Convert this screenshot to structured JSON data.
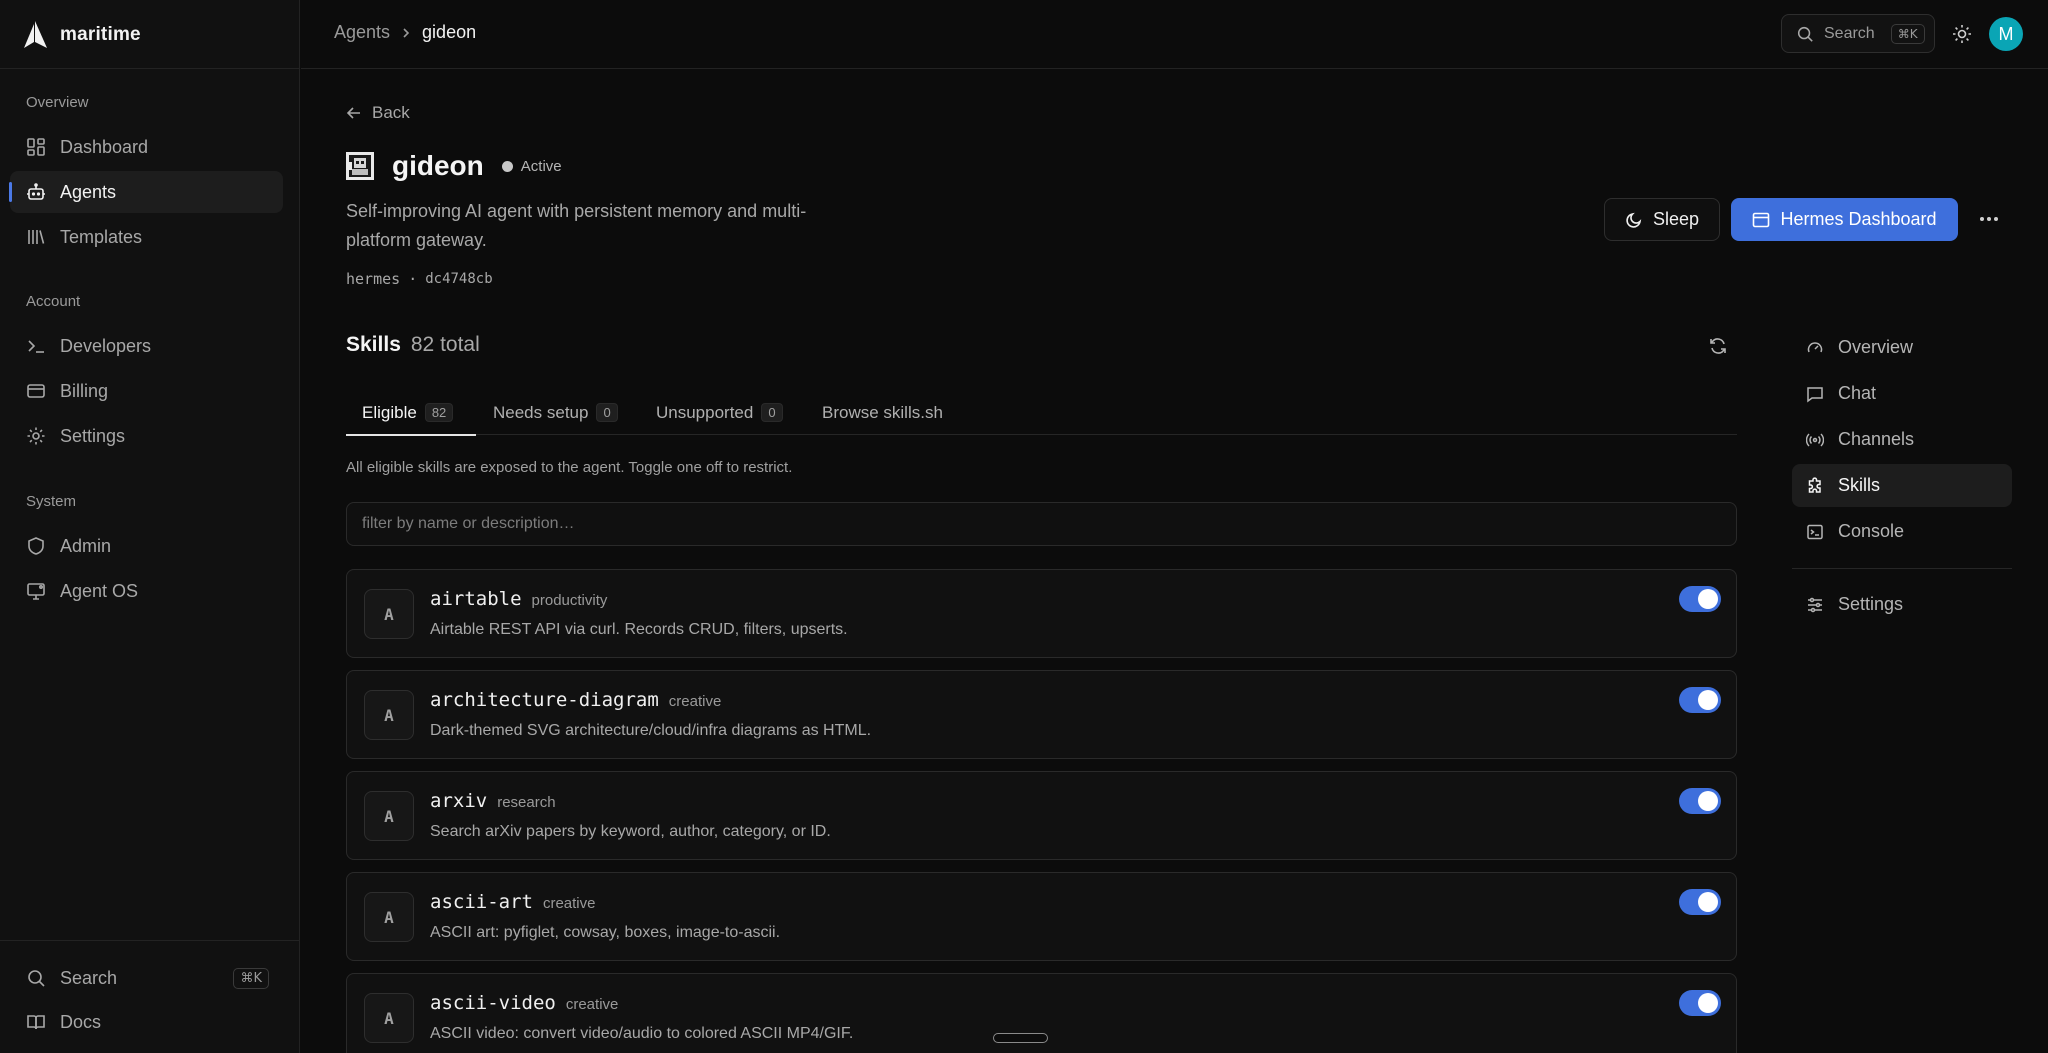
{
  "brand": {
    "name": "maritime"
  },
  "sidebar": {
    "sections": [
      {
        "label": "Overview",
        "items": [
          {
            "label": "Dashboard",
            "icon": "dashboard-icon"
          },
          {
            "label": "Agents",
            "icon": "bot-icon",
            "active": true
          },
          {
            "label": "Templates",
            "icon": "library-icon"
          }
        ]
      },
      {
        "label": "Account",
        "items": [
          {
            "label": "Developers",
            "icon": "terminal-prompt-icon"
          },
          {
            "label": "Billing",
            "icon": "credit-card-icon"
          },
          {
            "label": "Settings",
            "icon": "gear-icon"
          }
        ]
      },
      {
        "label": "System",
        "items": [
          {
            "label": "Admin",
            "icon": "shield-icon"
          },
          {
            "label": "Agent OS",
            "icon": "monitor-icon"
          }
        ]
      }
    ],
    "footer": {
      "search_label": "Search",
      "search_shortcut": "⌘K",
      "docs_label": "Docs"
    }
  },
  "topbar": {
    "breadcrumb": [
      "Agents",
      "gideon"
    ],
    "search_label": "Search",
    "search_shortcut": "⌘K",
    "avatar_initial": "M"
  },
  "agent": {
    "back_label": "Back",
    "name": "gideon",
    "status": "Active",
    "description": "Self-improving AI agent with persistent memory and multi-platform gateway.",
    "runtime": "hermes",
    "separator": "·",
    "commit": "dc4748cb",
    "sleep_label": "Sleep",
    "dashboard_label": "Hermes Dashboard"
  },
  "skills": {
    "title": "Skills",
    "total": "82 total",
    "tabs": [
      {
        "label": "Eligible",
        "count": "82",
        "active": true
      },
      {
        "label": "Needs setup",
        "count": "0"
      },
      {
        "label": "Unsupported",
        "count": "0"
      },
      {
        "label": "Browse skills.sh"
      }
    ],
    "hint": "All eligible skills are exposed to the agent. Toggle one off to restrict.",
    "filter_placeholder": "filter by name or description…",
    "items": [
      {
        "initial": "A",
        "name": "airtable",
        "category": "productivity",
        "description": "Airtable REST API via curl. Records CRUD, filters, upserts.",
        "enabled": true
      },
      {
        "initial": "A",
        "name": "architecture-diagram",
        "category": "creative",
        "description": "Dark-themed SVG architecture/cloud/infra diagrams as HTML.",
        "enabled": true
      },
      {
        "initial": "A",
        "name": "arxiv",
        "category": "research",
        "description": "Search arXiv papers by keyword, author, category, or ID.",
        "enabled": true
      },
      {
        "initial": "A",
        "name": "ascii-art",
        "category": "creative",
        "description": "ASCII art: pyfiglet, cowsay, boxes, image-to-ascii.",
        "enabled": true
      },
      {
        "initial": "A",
        "name": "ascii-video",
        "category": "creative",
        "description": "ASCII video: convert video/audio to colored ASCII MP4/GIF.",
        "enabled": true
      }
    ]
  },
  "right_nav": {
    "items": [
      {
        "label": "Overview",
        "icon": "gauge-icon"
      },
      {
        "label": "Chat",
        "icon": "message-icon"
      },
      {
        "label": "Channels",
        "icon": "broadcast-icon"
      },
      {
        "label": "Skills",
        "icon": "puzzle-icon",
        "active": true
      },
      {
        "label": "Console",
        "icon": "console-icon"
      }
    ],
    "settings_label": "Settings"
  },
  "colors": {
    "accent": "#3e6fdc",
    "avatar": "#0aa5b5",
    "background": "#0c0c0c",
    "sidebar": "#111111"
  }
}
